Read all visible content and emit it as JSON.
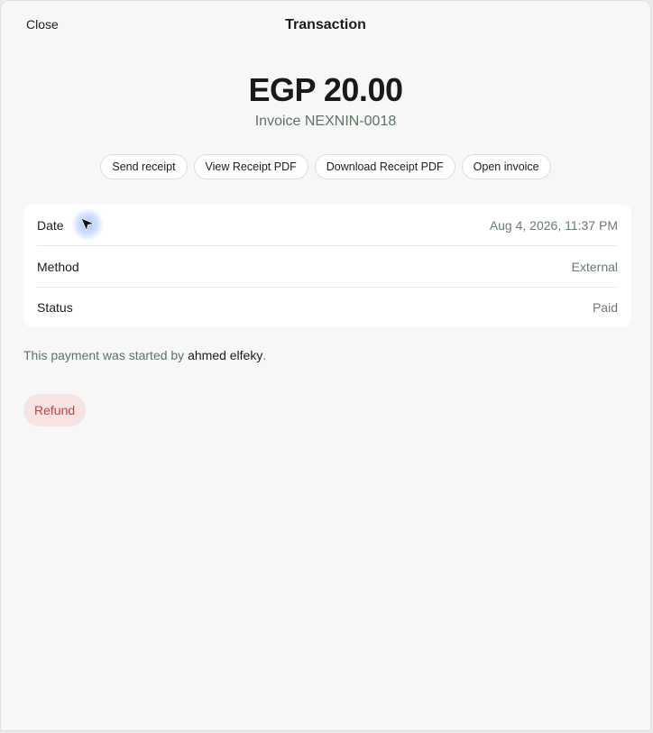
{
  "header": {
    "close_label": "Close",
    "title": "Transaction"
  },
  "summary": {
    "amount": "EGP 20.00",
    "invoice_ref": "Invoice NEXNIN-0018"
  },
  "actions": {
    "send_receipt": "Send receipt",
    "view_receipt_pdf": "View Receipt PDF",
    "download_receipt_pdf": "Download Receipt PDF",
    "open_invoice": "Open invoice"
  },
  "details": {
    "date_label": "Date",
    "date_value": "Aug 4, 2026, 11:37 PM",
    "method_label": "Method",
    "method_value": "External",
    "status_label": "Status",
    "status_value": "Paid"
  },
  "footer": {
    "started_prefix": "This payment was started by ",
    "started_user": "ahmed elfeky",
    "started_suffix": ".",
    "refund_label": "Refund"
  },
  "colors": {
    "accent_text": "#5f7365",
    "danger": "#d63b3b",
    "danger_bg": "#f6e3e3",
    "cursor_glow": "#5a8cff"
  }
}
